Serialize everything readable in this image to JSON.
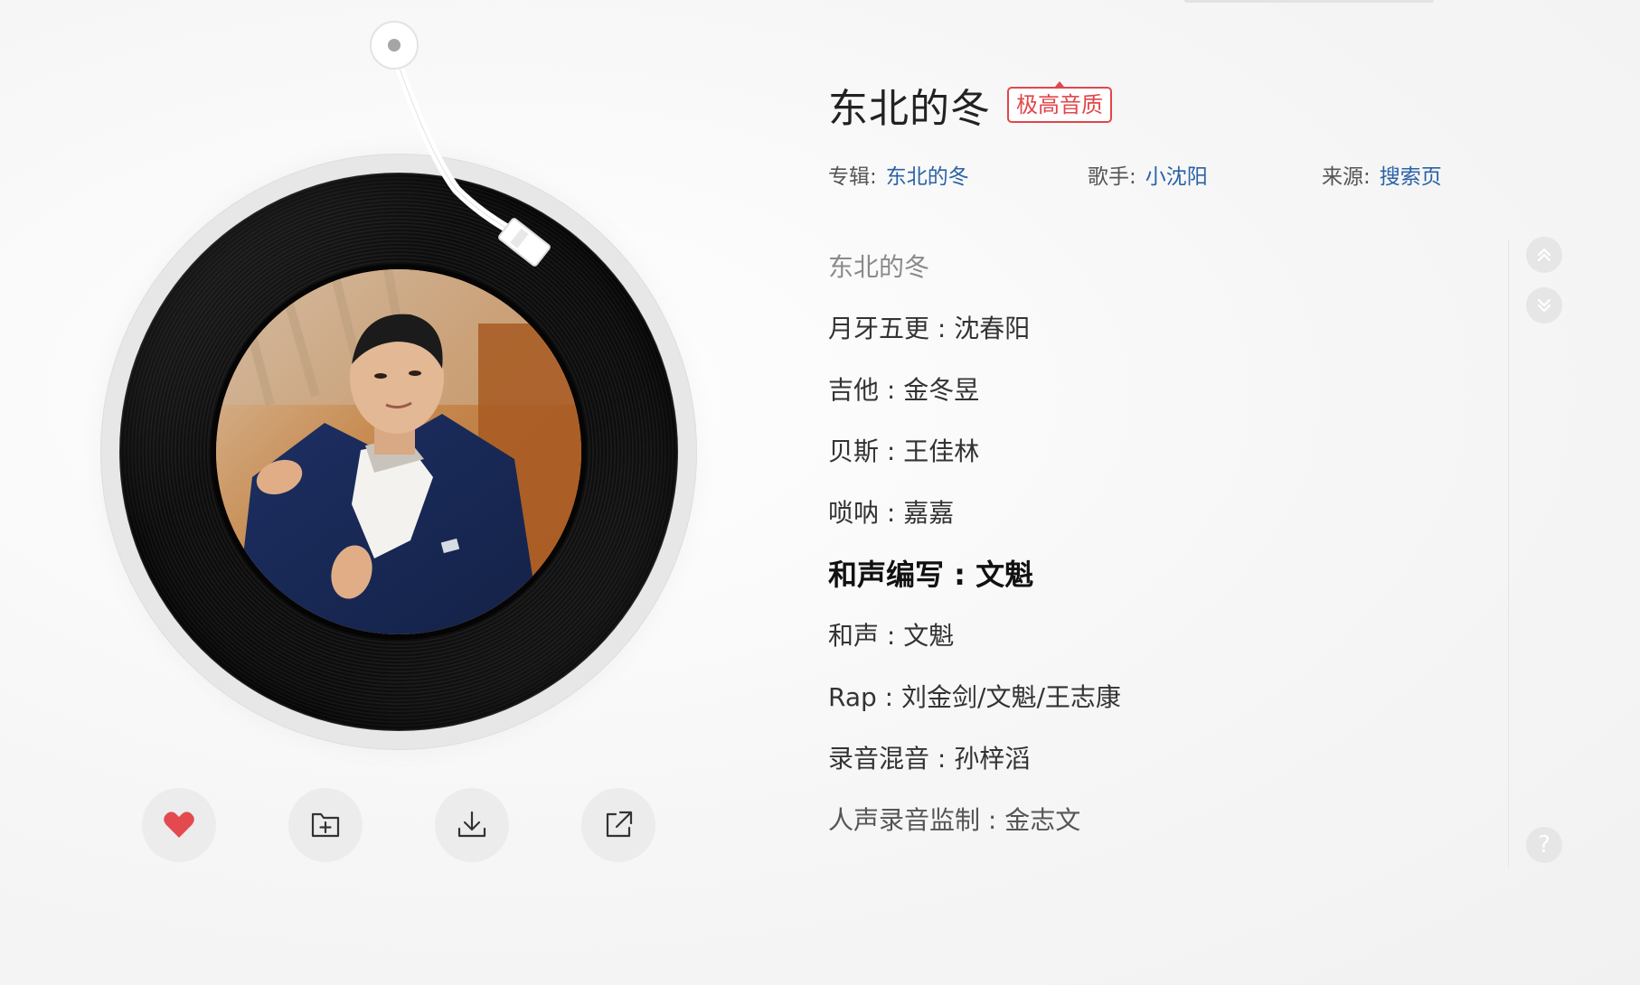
{
  "song": {
    "title": "东北的冬",
    "quality": "极高音质"
  },
  "meta": {
    "album_key": "专辑:",
    "album_value": "东北的冬",
    "artist_key": "歌手:",
    "artist_value": "小沈阳",
    "source_key": "来源:",
    "source_value": "搜索页"
  },
  "lyrics": [
    "东北的冬",
    "月牙五更 : 沈春阳",
    "吉他 : 金冬昱",
    "贝斯 : 王佳林",
    "唢呐 : 嘉嘉",
    "和声编写 : 文魁",
    "和声 : 文魁",
    "Rap : 刘金剑/文魁/王志康",
    "录音混音 : 孙梓滔",
    "人声录音监制 : 金志文"
  ],
  "active_lyric_index": 5,
  "actions": [
    {
      "name": "like-button",
      "icon": "heart-icon"
    },
    {
      "name": "add-to-playlist-button",
      "icon": "folder-plus-icon"
    },
    {
      "name": "download-button",
      "icon": "download-icon"
    },
    {
      "name": "share-button",
      "icon": "share-icon"
    }
  ],
  "side_controls": {
    "scroll_up": "chevrons-up-icon",
    "scroll_down": "chevrons-down-icon",
    "help_label": "?"
  },
  "colors": {
    "accent_red": "#e0464b",
    "link_blue": "#2a62a6",
    "heart_red": "#e34a4f"
  }
}
